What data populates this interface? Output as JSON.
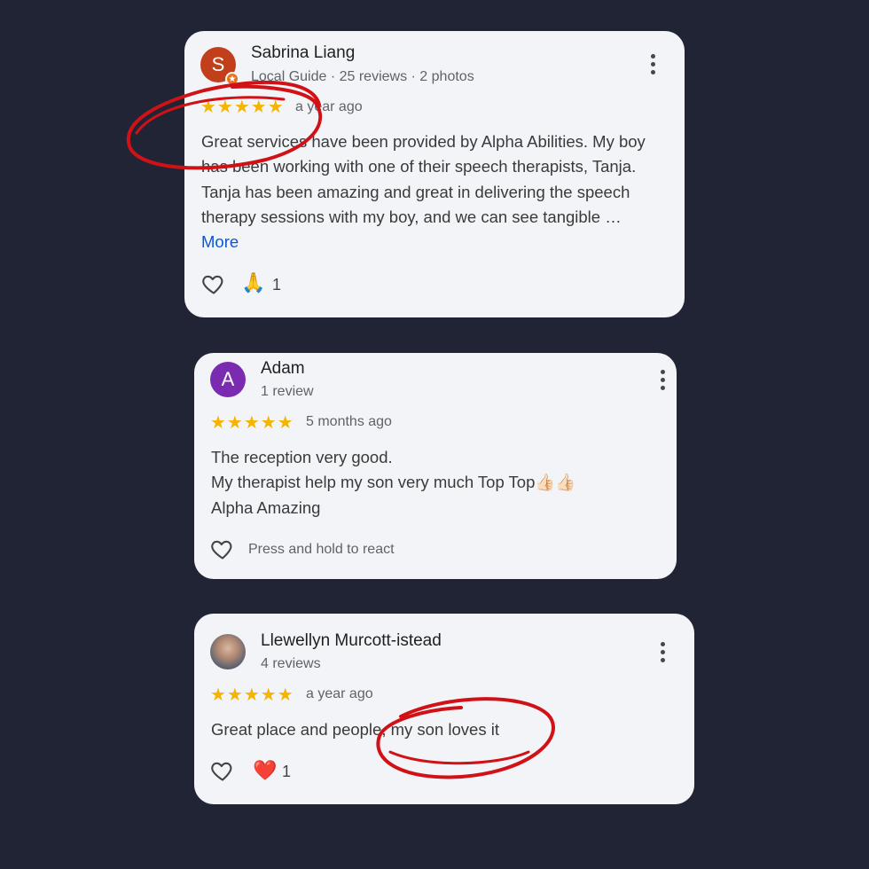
{
  "reviews": [
    {
      "avatar_letter": "S",
      "avatar_color": "#c1401b",
      "guide_badge": "★",
      "name": "Sabrina Liang",
      "meta": "Local Guide · 25 reviews · 2 photos",
      "stars": "★★★★★",
      "when": "a year ago",
      "text": "Great services have been provided by Alpha Abilities. My boy has been working with one of their speech therapists, Tanja. Tanja has been amazing and great in delivering the speech therapy sessions with my boy, and we can see tangible … ",
      "more": "More",
      "reaction_emoji": "🙏",
      "reaction_count": "1"
    },
    {
      "avatar_letter": "A",
      "avatar_color": "#7b2bb0",
      "name": "Adam",
      "meta": "1 review",
      "stars": "★★★★★",
      "when": "5 months ago",
      "text_lines": [
        "The reception very good.",
        "My therapist help my son very much Top Top👍🏻👍🏻",
        "Alpha Amazing"
      ],
      "press_hint": "Press and hold to react"
    },
    {
      "name": "Llewellyn Murcott-istead",
      "meta": "4 reviews",
      "stars": "★★★★★",
      "when": "a year ago",
      "text": "Great place and people, my son loves it",
      "reaction_emoji": "❤️",
      "reaction_count": "1"
    }
  ],
  "colors": {
    "background": "#212434",
    "card": "#f3f4f8",
    "star": "#f4b400",
    "link": "#0b57d0",
    "annotation": "#d01217"
  }
}
